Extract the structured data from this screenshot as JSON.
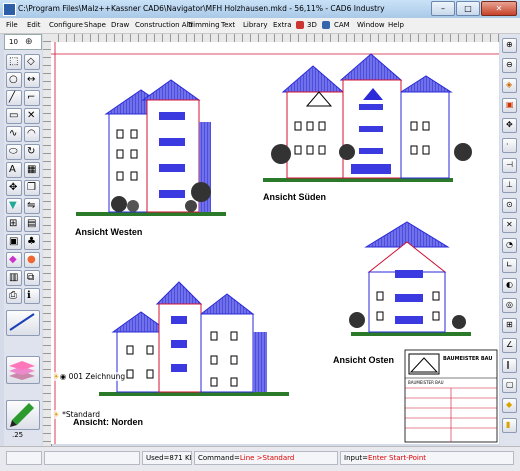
{
  "window": {
    "title": "C:\\Program Files\\Malz++Kassner CAD6\\Navigator\\MFH Holzhausen.mkd - 56,11% - CAD6 Industry"
  },
  "menu": {
    "items": [
      "File",
      "Edit",
      "Configure",
      "Shape",
      "Draw",
      "Construction Aid",
      "Trimming",
      "Text",
      "Library",
      "Extra",
      "3D",
      "CAM",
      "Window",
      "Help"
    ]
  },
  "toolbar": {
    "zoom_value": "10"
  },
  "views": {
    "west": "Ansicht Westen",
    "south": "Ansicht Süden",
    "east": "Ansicht Osten",
    "north": "Ansicht: Norden"
  },
  "layers": {
    "drawing": "001 Zeichnung",
    "standard": "*Standard"
  },
  "line_width": ".25",
  "titleblock": {
    "name": "BAUMEISTER BAU",
    "name2": "BAUMEISTER BAU"
  },
  "status": {
    "used": "Used=871 KB",
    "command_prefix": "Command=",
    "command_value": "Line >Standard",
    "input_prefix": "Input=",
    "input_value": "Enter Start-Point"
  },
  "colors": {
    "accent_blue": "#2a2ad8",
    "accent_red": "#d01030",
    "roof": "#5a5ae0"
  }
}
